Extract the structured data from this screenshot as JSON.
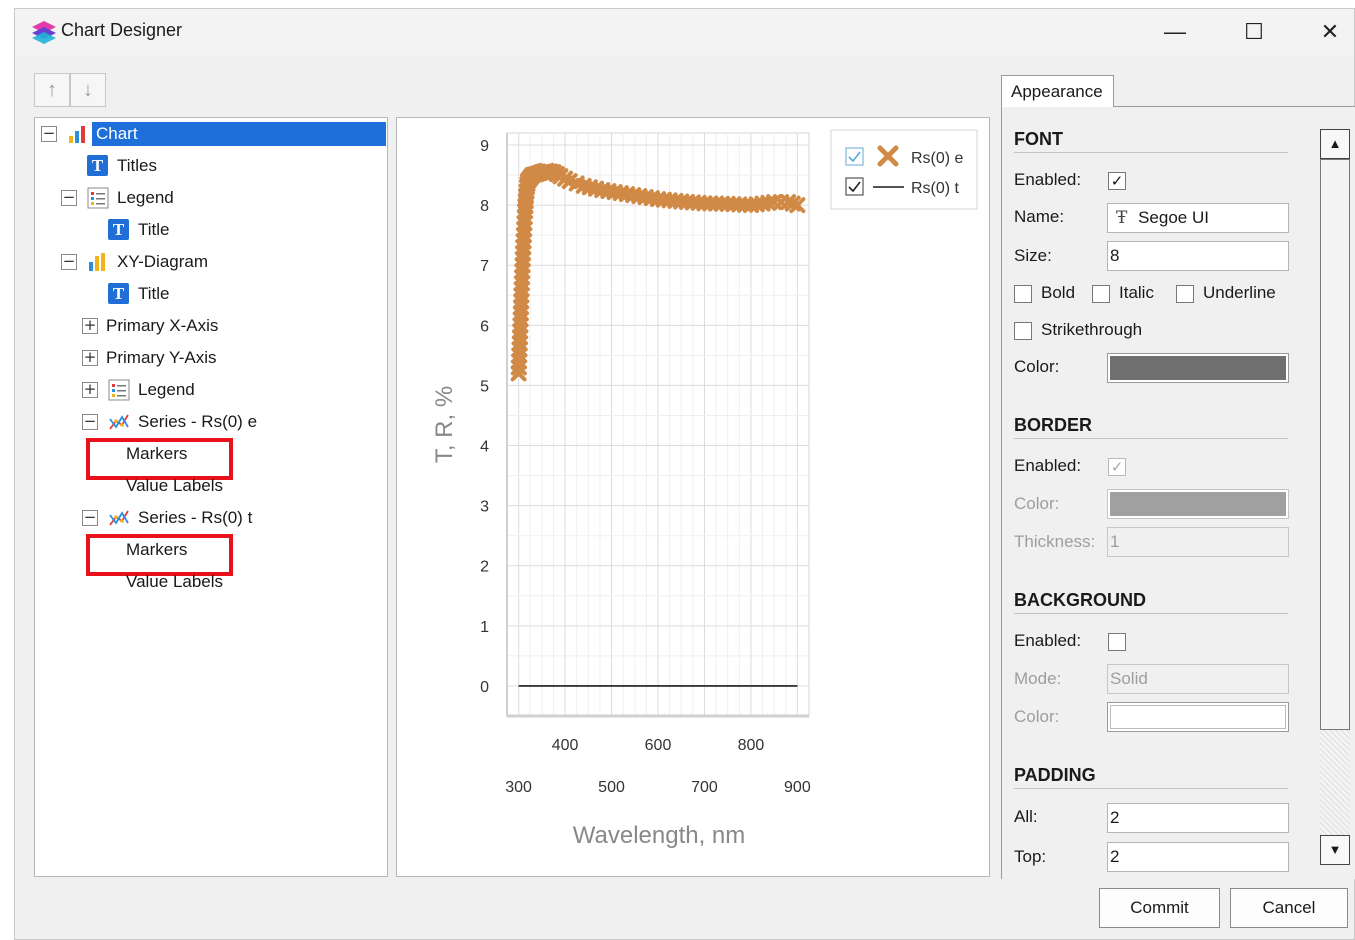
{
  "window": {
    "title": "Chart Designer",
    "controls": {
      "minimize": "—",
      "maximize": "☐",
      "close": "✕"
    }
  },
  "toolbar": {
    "move_up": "↑",
    "move_down": "↓"
  },
  "tree": {
    "selected": "Chart",
    "items": [
      {
        "label": "Chart",
        "expander": "−",
        "icon": "bar-chart-icon"
      },
      {
        "label": "Titles",
        "icon": "text-icon",
        "glyph": "T"
      },
      {
        "label": "Legend",
        "expander": "−",
        "icon": "legend-icon"
      },
      {
        "label": "Title",
        "icon": "text-icon",
        "glyph": "T"
      },
      {
        "label": "XY-Diagram",
        "expander": "−",
        "icon": "bar-chart-icon"
      },
      {
        "label": "Title",
        "icon": "text-icon",
        "glyph": "T"
      },
      {
        "label": "Primary X-Axis",
        "expander": "+"
      },
      {
        "label": "Primary Y-Axis",
        "expander": "+"
      },
      {
        "label": "Legend",
        "expander": "+",
        "icon": "legend-icon"
      },
      {
        "label": "Series - Rs(0) e",
        "expander": "−",
        "icon": "series-icon"
      },
      {
        "label": "Markers",
        "highlighted": true
      },
      {
        "label": "Value Labels"
      },
      {
        "label": "Series - Rs(0) t",
        "expander": "−",
        "icon": "series-icon"
      },
      {
        "label": "Markers",
        "highlighted": true
      },
      {
        "label": "Value Labels"
      }
    ]
  },
  "chart_data": {
    "type": "scatter",
    "title": "",
    "xlabel": "Wavelength, nm",
    "ylabel": "T, R, %",
    "xlim": [
      275,
      925
    ],
    "ylim": [
      -0.5,
      9.2
    ],
    "x_ticks_top_row": [
      "400",
      "600",
      "800"
    ],
    "x_ticks_bottom_row": [
      "300",
      "500",
      "700",
      "900"
    ],
    "y_ticks": [
      "0",
      "1",
      "2",
      "3",
      "4",
      "5",
      "6",
      "7",
      "8",
      "9"
    ],
    "grid": true,
    "legend_position": "top-right",
    "series": [
      {
        "name": "Rs(0) e",
        "marker": "x",
        "color": "#d08a45",
        "x": [
          300,
          302,
          304,
          306,
          308,
          310,
          312,
          314,
          316,
          318,
          320,
          325,
          330,
          340,
          350,
          360,
          375,
          390,
          410,
          440,
          480,
          520,
          560,
          600,
          650,
          700,
          750,
          800,
          850,
          880,
          900
        ],
        "y": [
          5.2,
          5.6,
          6.0,
          6.5,
          6.9,
          7.3,
          7.6,
          7.9,
          8.15,
          8.3,
          8.4,
          8.45,
          8.5,
          8.52,
          8.55,
          8.57,
          8.55,
          8.48,
          8.4,
          8.32,
          8.25,
          8.2,
          8.15,
          8.1,
          8.06,
          8.03,
          8.02,
          8.0,
          8.05,
          8.05,
          8.0
        ]
      },
      {
        "name": "Rs(0) t",
        "marker": "none",
        "line": "solid",
        "color": "#1a1a1a",
        "x": [
          300,
          900
        ],
        "y": [
          0,
          0
        ]
      }
    ]
  },
  "appearance": {
    "tab": "Appearance",
    "font": {
      "header": "FONT",
      "enabled_label": "Enabled:",
      "enabled": "✓",
      "name_label": "Name:",
      "name": "Segoe UI",
      "name_icon": "Ŧ",
      "size_label": "Size:",
      "size": "8",
      "bold": "Bold",
      "italic": "Italic",
      "underline": "Underline",
      "strikethrough": "Strikethrough",
      "color_label": "Color:",
      "color": "#707070"
    },
    "border": {
      "header": "BORDER",
      "enabled_label": "Enabled:",
      "enabled": "✓",
      "color_label": "Color:",
      "color": "#a0a0a0",
      "thickness_label": "Thickness:",
      "thickness": "1"
    },
    "background": {
      "header": "BACKGROUND",
      "enabled_label": "Enabled:",
      "mode_label": "Mode:",
      "mode": "Solid",
      "color_label": "Color:",
      "color": "#ffffff"
    },
    "padding": {
      "header": "PADDING",
      "all_label": "All:",
      "all": "2",
      "top_label": "Top:",
      "top": "2"
    }
  },
  "scrollbar": {
    "up": "▲",
    "down": "▼"
  },
  "buttons": {
    "commit": "Commit",
    "cancel": "Cancel"
  }
}
